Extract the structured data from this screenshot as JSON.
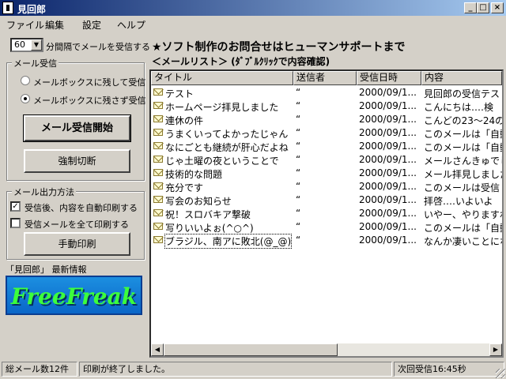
{
  "window": {
    "title": "見回郎",
    "min": "_",
    "max": "□",
    "close": "×"
  },
  "menu": [
    "ファイル",
    "編集",
    "設定",
    "ヘルプ"
  ],
  "interval": {
    "value": "60",
    "label": "分間隔でメールを受信する"
  },
  "receive_group": {
    "legend": "メール受信",
    "options": [
      "メールボックスに残して受信",
      "メールボックスに残さず受信"
    ],
    "selected_index": 1,
    "start_button": "メール受信開始",
    "disconnect_button": "強制切断"
  },
  "output_group": {
    "legend": "メール出力方法",
    "auto_print": {
      "label": "受信後、内容を自動印刷する",
      "checked": true
    },
    "print_all": {
      "label": "受信メールを全て印刷する",
      "checked": false
    },
    "manual_print_button": "手動印刷"
  },
  "info": {
    "label": "「見回郎」 最新情報",
    "banner_text": "FreeFreak"
  },
  "heading": "★ソフト制作のお問合せはヒューマンサポートまで",
  "subheading": "＜メールリスト＞ (ﾀﾞﾌﾞﾙｸﾘｯｸで内容確認)",
  "list": {
    "columns": [
      "タイトル",
      "送信者",
      "受信日時",
      "内容"
    ],
    "rows": [
      {
        "title": "テスト",
        "sender": "“",
        "date": "2000/09/1...",
        "content": "見回郎の受信テス"
      },
      {
        "title": "ホームページ拝見しました",
        "sender": "“",
        "date": "2000/09/1...",
        "content": "こんにちは‥‥検"
      },
      {
        "title": "連休の件",
        "sender": "“",
        "date": "2000/09/1...",
        "content": "こんどの23～24の"
      },
      {
        "title": "うまくいってよかったじゃん",
        "sender": "“",
        "date": "2000/09/1...",
        "content": "このメールは「自動"
      },
      {
        "title": "なにごとも継続が肝心だよね",
        "sender": "“",
        "date": "2000/09/1...",
        "content": "このメールは「自動"
      },
      {
        "title": "じゃ土曜の夜ということで",
        "sender": "“",
        "date": "2000/09/1...",
        "content": "メールさんきゅでし"
      },
      {
        "title": "技術的な問題",
        "sender": "“",
        "date": "2000/09/1...",
        "content": "メール拝見しました"
      },
      {
        "title": "充分です",
        "sender": "“",
        "date": "2000/09/1...",
        "content": "このメールは受信"
      },
      {
        "title": "写会のお知らせ",
        "sender": "“",
        "date": "2000/09/1...",
        "content": "拝啓‥‥いよいよ"
      },
      {
        "title": "祝！スロバキア撃破",
        "sender": "“",
        "date": "2000/09/1...",
        "content": "いやー、やりますね"
      },
      {
        "title": "写りいいよぉ(^○^)",
        "sender": "“",
        "date": "2000/09/1...",
        "content": "このメールは「自動"
      },
      {
        "title": "ブラジル、南アに敗北(@_@)",
        "sender": "“",
        "date": "2000/09/1...",
        "content": "なんか凄いことにな"
      }
    ],
    "selected_index": 11
  },
  "status": {
    "total": "総メール数12件",
    "message": "印刷が終了しました。",
    "next": "次回受信16:45秒"
  }
}
